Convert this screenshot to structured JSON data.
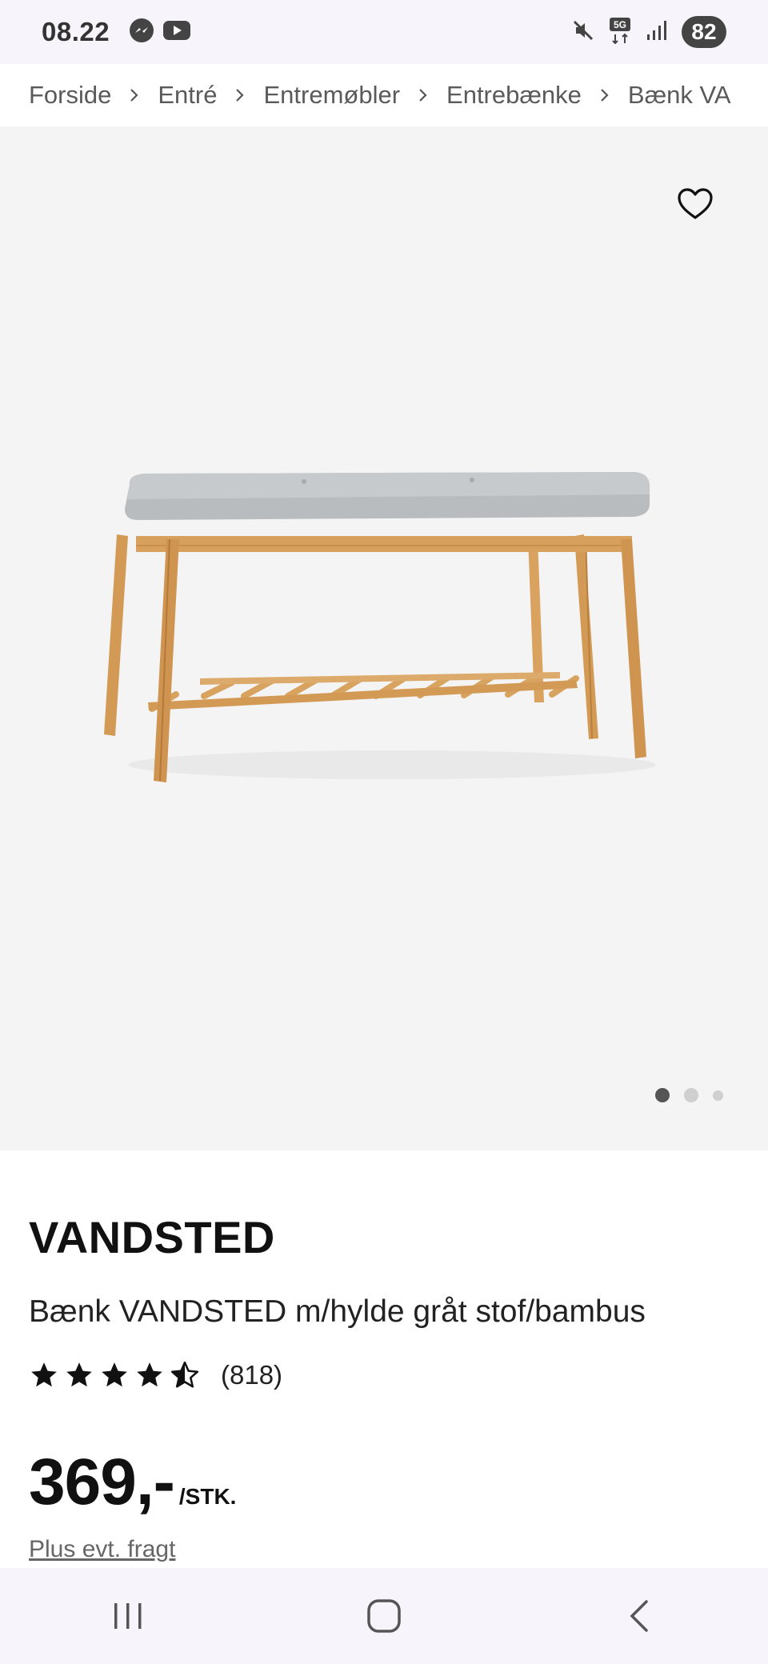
{
  "status_bar": {
    "time": "08.22",
    "battery": "82",
    "icons": [
      "messenger-icon",
      "youtube-icon",
      "mute-icon",
      "5g-icon",
      "signal-icon"
    ]
  },
  "breadcrumb": [
    "Forside",
    "Entré",
    "Entremøbler",
    "Entrebænke",
    "Bænk VA"
  ],
  "gallery": {
    "image_count": 3,
    "active_index": 0
  },
  "product": {
    "brand": "VANDSTED",
    "name": "Bænk VANDSTED m/hylde gråt stof/bambus",
    "rating": 4.5,
    "rating_count": "(818)",
    "price": "369,-",
    "price_unit": "/STK.",
    "shipping_link": "Plus evt. fragt"
  },
  "colors": {
    "gallery_bg": "#f4f4f4",
    "text": "#111111",
    "muted": "#666666"
  }
}
